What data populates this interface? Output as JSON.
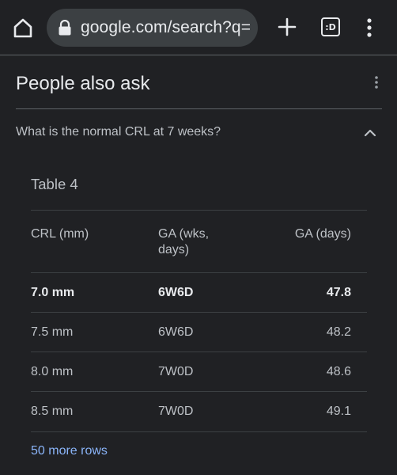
{
  "browser": {
    "url": "google.com/search?q=",
    "tab_count": ":D",
    "icons": {
      "home": "home-icon",
      "lock": "lock-icon",
      "new_tab": "plus-icon",
      "tabs": "tab-switcher-icon",
      "menu": "more-vert-icon"
    }
  },
  "paa": {
    "title": "People also ask",
    "question": "What is the normal CRL at 7 weeks?",
    "table_title": "Table 4",
    "headers": [
      "CRL (mm)",
      "GA (wks, days)",
      "GA (days)"
    ],
    "rows": [
      {
        "crl": "7.0 mm",
        "ga_wks": "6W6D",
        "ga_days": "47.8",
        "highlight": true
      },
      {
        "crl": "7.5 mm",
        "ga_wks": "6W6D",
        "ga_days": "48.2",
        "highlight": false
      },
      {
        "crl": "8.0 mm",
        "ga_wks": "7W0D",
        "ga_days": "48.6",
        "highlight": false
      },
      {
        "crl": "8.5 mm",
        "ga_wks": "7W0D",
        "ga_days": "49.1",
        "highlight": false
      }
    ],
    "more_rows_link": "50 more rows"
  },
  "colors": {
    "background": "#202124",
    "text": "#e8eaed",
    "secondary_text": "#bdc1c6",
    "link": "#8ab4f8",
    "url_bar": "#3c4043"
  }
}
